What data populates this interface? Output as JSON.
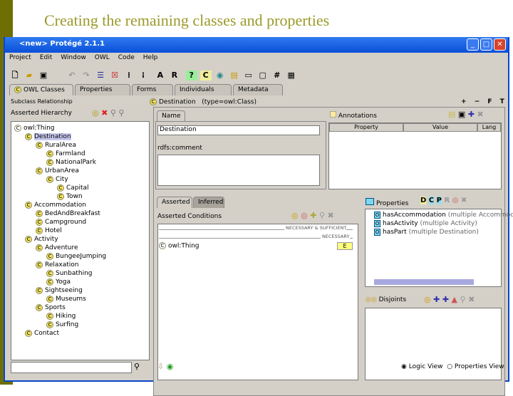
{
  "slide_title": "Creating the remaining classes and properties",
  "window": {
    "title": "<new> Protégé 2.1.1",
    "minimize": "_",
    "maximize": "□",
    "close": "✕"
  },
  "menu": [
    "Project",
    "Edit",
    "Window",
    "OWL",
    "Code",
    "Help"
  ],
  "toolbar": {
    "a": "A",
    "r": "R"
  },
  "tabs": [
    "OWL Classes",
    "Properties",
    "Forms",
    "Individuals",
    "Metadata"
  ],
  "left": {
    "header": "Subclass Relationship",
    "hierarchy_label": "Asserted Hierarchy",
    "tree": [
      {
        "label": "owl:Thing",
        "level": 0
      },
      {
        "label": "Destination",
        "level": 1,
        "selected": true
      },
      {
        "label": "RuralArea",
        "level": 2
      },
      {
        "label": "Farmland",
        "level": 3
      },
      {
        "label": "NationalPark",
        "level": 3
      },
      {
        "label": "UrbanArea",
        "level": 2
      },
      {
        "label": "City",
        "level": 3
      },
      {
        "label": "Capital",
        "level": 4
      },
      {
        "label": "Town",
        "level": 4
      },
      {
        "label": "Accommodation",
        "level": 1
      },
      {
        "label": "BedAndBreakfast",
        "level": 2
      },
      {
        "label": "Campground",
        "level": 2
      },
      {
        "label": "Hotel",
        "level": 2
      },
      {
        "label": "Activity",
        "level": 1
      },
      {
        "label": "Adventure",
        "level": 2
      },
      {
        "label": "BungeeJumping",
        "level": 3
      },
      {
        "label": "Relaxation",
        "level": 2
      },
      {
        "label": "Sunbathing",
        "level": 3
      },
      {
        "label": "Yoga",
        "level": 3
      },
      {
        "label": "Sightseeing",
        "level": 2
      },
      {
        "label": "Museums",
        "level": 3
      },
      {
        "label": "Sports",
        "level": 2
      },
      {
        "label": "Hiking",
        "level": 3
      },
      {
        "label": "Surfing",
        "level": 3
      },
      {
        "label": "Contact",
        "level": 1
      }
    ],
    "search_value": ""
  },
  "detail": {
    "title": "Destination",
    "type": "(type=owl:Class)",
    "controls": [
      "+",
      "−",
      "F",
      "T"
    ],
    "name_tab": "Name",
    "name_value": "Destination",
    "comment_label": "rdfs:comment",
    "annotations_label": "Annotations",
    "ann_columns": [
      "Property",
      "Value",
      "Lang"
    ],
    "cond_tabs": [
      "Asserted",
      "Inferred"
    ],
    "cond_label": "Asserted Conditions",
    "necsuf": "NECESSARY & SUFFICIENT",
    "nec": "NECESSARY",
    "cond_item": "owl:Thing",
    "cond_badge": "E",
    "properties_label": "Properties",
    "properties": [
      {
        "name": "hasAccommodation",
        "range": "(multiple Accommodation)"
      },
      {
        "name": "hasActivity",
        "range": "(multiple Activity)"
      },
      {
        "name": "hasPart",
        "range": "(multiple Destination)"
      }
    ],
    "disjoints_label": "Disjoints",
    "views": [
      "Logic View",
      "Properties View"
    ],
    "selected_view": "Logic View"
  }
}
